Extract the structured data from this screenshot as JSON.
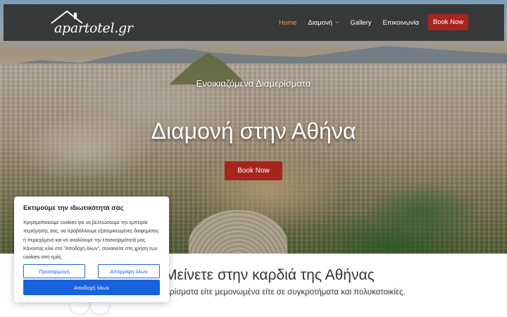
{
  "header": {
    "logo_text": "apartotel.gr",
    "nav": [
      {
        "label": "Home",
        "active": true
      },
      {
        "label": "Διαμονή",
        "has_dropdown": true
      },
      {
        "label": "Gallery"
      },
      {
        "label": "Επικοινωνία"
      }
    ],
    "book_label": "Book Now"
  },
  "hero": {
    "subtitle": "Ενοικιαζόμενα Διαμερίσματα",
    "title": "Διαμονή στην Αθήνα",
    "book_label": "Book Now"
  },
  "section": {
    "title": "Μείνετε στην καρδιά της Αθήνας",
    "text": "ερίσματα είτε μεμονωμένα είτε σε συγκροτήματα και πολυκατοικίες."
  },
  "cookie": {
    "title": "Εκτιμούμε την ιδιωτικότητά σας",
    "text": "Χρησιμοποιούμε cookies για να βελτιώσουμε την εμπειρία περιήγησής σας, να προβάλλουμε εξατομικευμένες διαφημίσεις ή περιεχόμενο και να αναλύουμε την επισκεψιμότητά μας. Κάνοντας κλικ στο \"Αποδοχή όλων\", συναινείτε στη χρήση των cookies από εμάς.",
    "customize_label": "Προσαρμογή",
    "reject_label": "Απόρριψη όλων",
    "accept_label": "Αποδοχή όλων"
  },
  "colors": {
    "accent_red": "#a6261d",
    "nav_active": "#e8a33d",
    "cookie_blue": "#1863dc"
  },
  "icons": [
    "house-roof-logo-icon",
    "chevron-down-icon"
  ]
}
